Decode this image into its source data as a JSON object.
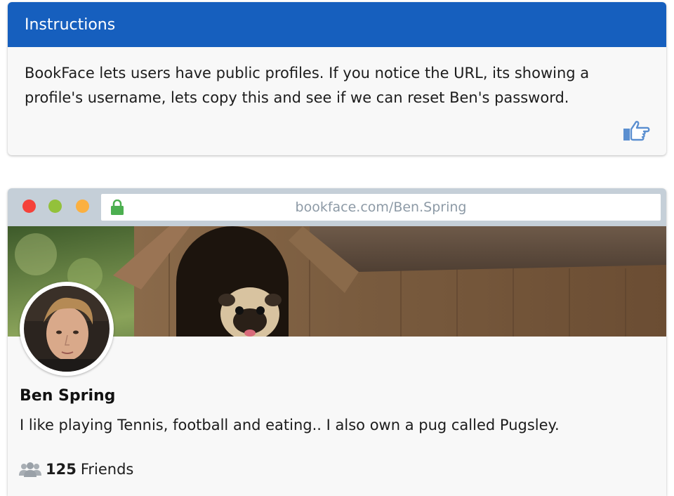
{
  "instructions": {
    "title": "Instructions",
    "body": "BookFace lets users have public profiles. If you notice the URL, its showing a profile's username, lets copy this and see if we can reset Ben's password.",
    "action_icon": "pointing-hand-icon"
  },
  "browser": {
    "url": "bookface.com/Ben.Spring",
    "lock_color": "#4caf50",
    "traffic_lights": [
      "#f5413a",
      "#93c13b",
      "#fbb040"
    ]
  },
  "profile": {
    "name": "Ben Spring",
    "bio": "I like playing Tennis, football and eating.. I also own a pug called Pugsley.",
    "friends_count": "125",
    "friends_label": "Friends"
  },
  "colors": {
    "header_blue": "#165fbe",
    "icon_blue": "#5b8fd0"
  }
}
